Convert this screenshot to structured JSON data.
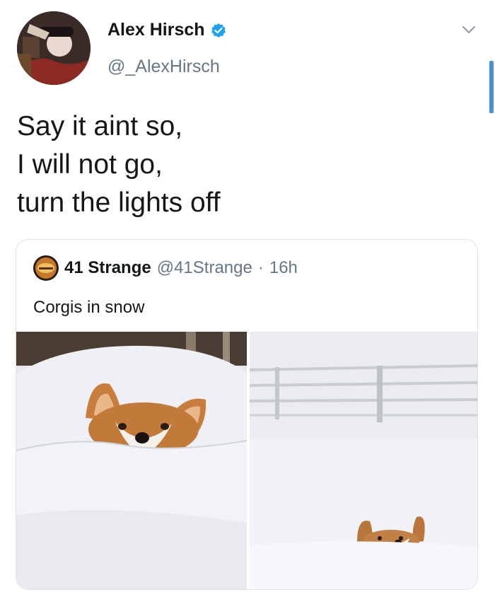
{
  "tweet": {
    "author": {
      "name": "Alex Hirsch",
      "handle": "@_AlexHirsch",
      "verified": true
    },
    "text_lines": [
      "Say it aint so,",
      "I will not go,",
      "turn the lights off"
    ],
    "quoted": {
      "author_name": "41 Strange",
      "author_handle": "@41Strange",
      "separator": "·",
      "time": "16h",
      "text": "Corgis in snow",
      "media": [
        {
          "icon": "corgi-close-photo"
        },
        {
          "icon": "corgi-fence-photo"
        }
      ]
    }
  },
  "colors": {
    "text": "#14171a",
    "secondary": "#657786",
    "verified": "#1da1f2",
    "border": "#dfe3e8",
    "scrollbar": "#4a90d9"
  }
}
